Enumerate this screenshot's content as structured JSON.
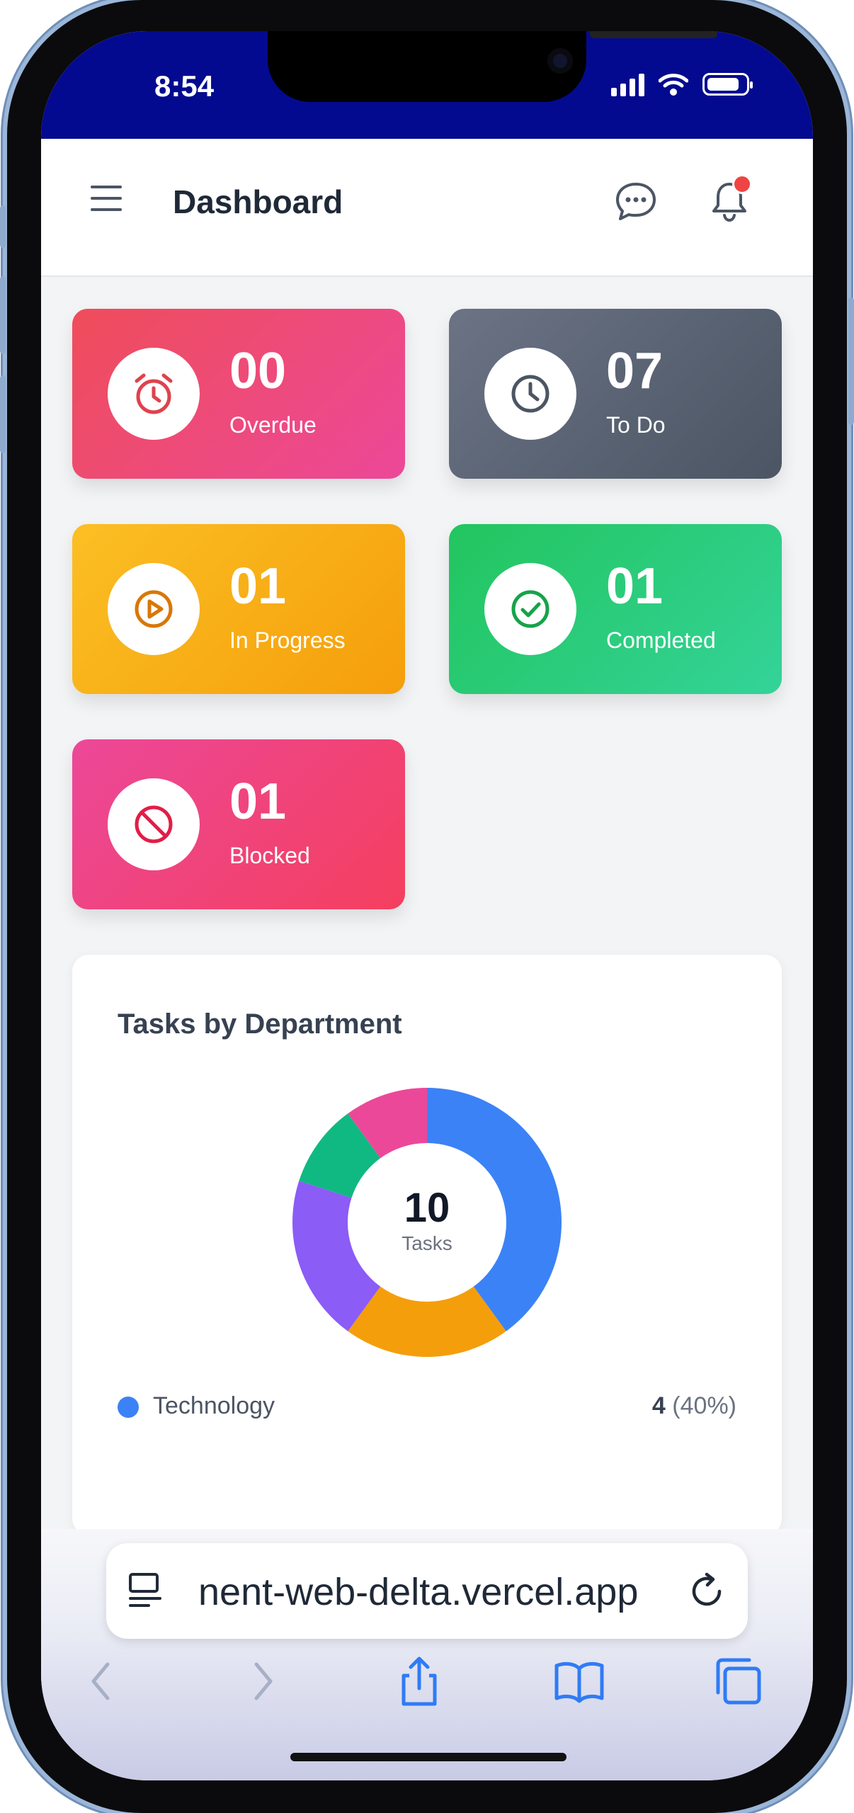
{
  "status_bar": {
    "time": "8:54"
  },
  "header": {
    "title": "Dashboard"
  },
  "cards": [
    {
      "count": "00",
      "label": "Overdue",
      "icon": "alarm-clock-icon",
      "color_from": "#ef4d5a",
      "color_to": "#ec4899",
      "icon_color": "#e0424d"
    },
    {
      "count": "07",
      "label": "To Do",
      "icon": "clock-icon",
      "color_from": "#6b7385",
      "color_to": "#4b5563",
      "icon_color": "#4b5563"
    },
    {
      "count": "01",
      "label": "In Progress",
      "icon": "play-circle-icon",
      "color_from": "#fbbf24",
      "color_to": "#f59e0b",
      "icon_color": "#d97706"
    },
    {
      "count": "01",
      "label": "Completed",
      "icon": "check-circle-icon",
      "color_from": "#22c55e",
      "color_to": "#34d399",
      "icon_color": "#16a34a"
    },
    {
      "count": "01",
      "label": "Blocked",
      "icon": "ban-icon",
      "color_from": "#ec4899",
      "color_to": "#f43f5e",
      "icon_color": "#e11d48"
    }
  ],
  "department_panel": {
    "title": "Tasks by Department",
    "total": "10",
    "total_label": "Tasks",
    "legend": [
      {
        "label": "Technology",
        "count": "4",
        "percent": "(40%)",
        "color": "#3b82f6"
      }
    ]
  },
  "chart_data": {
    "type": "pie",
    "title": "Tasks by Department",
    "center_value": 10,
    "slices": [
      {
        "name": "Technology",
        "value": 4,
        "color": "#3b82f6"
      },
      {
        "value": 2,
        "color": "#f59e0b"
      },
      {
        "value": 2,
        "color": "#8b5cf6"
      },
      {
        "value": 1,
        "color": "#10b981"
      },
      {
        "value": 1,
        "color": "#ec4899"
      }
    ]
  },
  "browser": {
    "url": "nent-web-delta.vercel.app"
  }
}
